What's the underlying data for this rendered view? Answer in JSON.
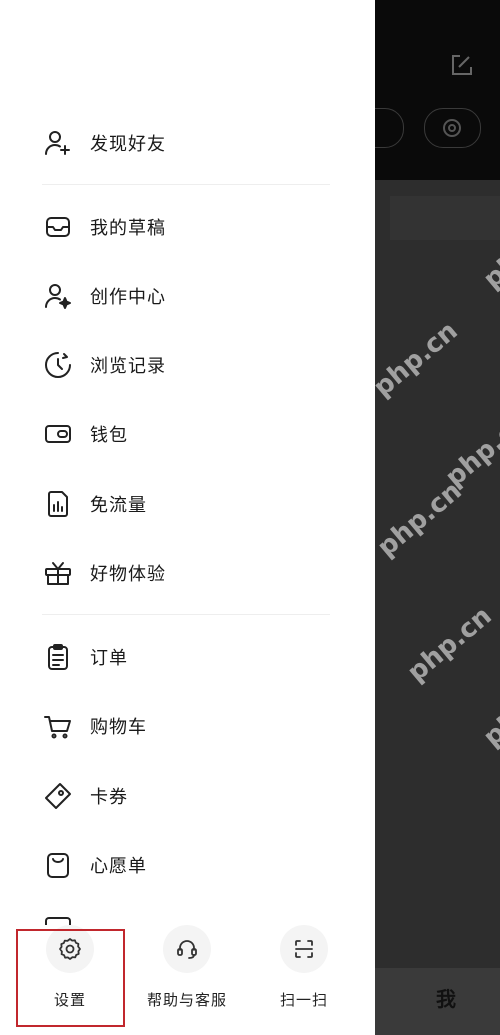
{
  "background": {
    "tab_me_label": "我",
    "watermark": "php.cn"
  },
  "drawer": {
    "section1": [
      {
        "label": "发现好友",
        "icon": "add-friend-icon"
      }
    ],
    "section2": [
      {
        "label": "我的草稿",
        "icon": "drafts-inbox-icon"
      },
      {
        "label": "创作中心",
        "icon": "creator-center-icon"
      },
      {
        "label": "浏览记录",
        "icon": "history-clock-icon"
      },
      {
        "label": "钱包",
        "icon": "wallet-icon"
      },
      {
        "label": "免流量",
        "icon": "data-free-icon"
      },
      {
        "label": "好物体验",
        "icon": "gift-icon"
      }
    ],
    "section3": [
      {
        "label": "订单",
        "icon": "order-clipboard-icon"
      },
      {
        "label": "购物车",
        "icon": "cart-icon"
      },
      {
        "label": "卡券",
        "icon": "coupon-tag-icon"
      },
      {
        "label": "心愿单",
        "icon": "wishlist-bag-icon"
      }
    ]
  },
  "bottom_bar": {
    "settings": {
      "label": "设置",
      "icon": "gear-icon"
    },
    "help": {
      "label": "帮助与客服",
      "icon": "headset-icon"
    },
    "scan": {
      "label": "扫一扫",
      "icon": "scan-icon"
    }
  },
  "colors": {
    "highlight_border": "#c1272d",
    "drawer_bg": "#ffffff",
    "overlay_bg": "#0a0a0a"
  }
}
